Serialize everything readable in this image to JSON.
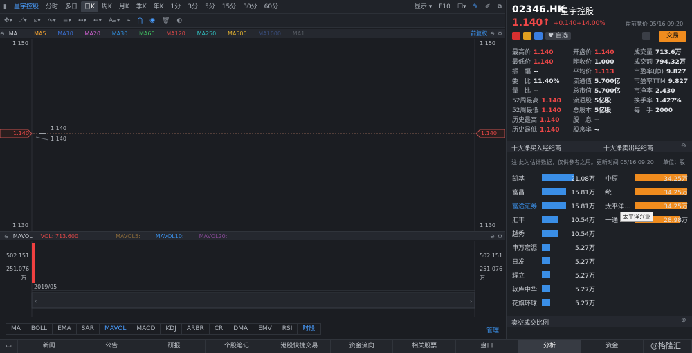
{
  "toolbar": {
    "symbol": "星宇控股",
    "periods": [
      "分时",
      "多日",
      "日K",
      "周K",
      "月K",
      "季K",
      "年K",
      "1分",
      "3分",
      "5分",
      "15分",
      "30分",
      "60分"
    ],
    "active_period": "日K",
    "display_label": "显示",
    "f10_label": "F10"
  },
  "ma_bar": {
    "title": "MA",
    "items": [
      {
        "label": "MA5:",
        "color": "#f0a030"
      },
      {
        "label": "MA10:",
        "color": "#3a6fd0"
      },
      {
        "label": "MA20:",
        "color": "#d060d0"
      },
      {
        "label": "MA30:",
        "color": "#3090e0"
      },
      {
        "label": "MA60:",
        "color": "#40c060"
      },
      {
        "label": "MA120:",
        "color": "#e04848"
      },
      {
        "label": "MA250:",
        "color": "#30c0c0"
      },
      {
        "label": "MA500:",
        "color": "#e0b030"
      },
      {
        "label": "MA1000:",
        "color": "#3a4f80"
      },
      {
        "label": "MA1",
        "color": "#555a62"
      }
    ],
    "adjust_label": "前复权"
  },
  "price_chart": {
    "y_top": "1.150",
    "y_bottom": "1.130",
    "last_price_tag": "1.140",
    "candle_label_1": "1.140",
    "candle_label_2": "1.140"
  },
  "vol_bar": {
    "title": "MAVOL",
    "vol_label": "VOL: 713.600",
    "items": [
      {
        "label": "MAVOL5:",
        "color": "#8a6a3a"
      },
      {
        "label": "MAVOL10:",
        "color": "#3a8ee6"
      },
      {
        "label": "MAVOL20:",
        "color": "#8a4a9a"
      }
    ]
  },
  "vol_chart": {
    "y_top": "502.151",
    "y_mid": "251.076",
    "unit": "万",
    "date_label": "2019/05"
  },
  "indicators": [
    "MA",
    "BOLL",
    "EMA",
    "SAR",
    "MAVOL",
    "MACD",
    "KDJ",
    "ARBR",
    "CR",
    "DMA",
    "EMV",
    "RSI",
    "时段"
  ],
  "active_indicators": [
    "MAVOL",
    "时段"
  ],
  "manage_label": "管理",
  "bottom_nav": [
    "新闻",
    "公告",
    "研报",
    "个股笔记",
    "港股快捷交易",
    "资金流向",
    "相关股票",
    "盘口",
    "分析",
    "资金"
  ],
  "bottom_nav_active": "分析",
  "watermark": "@格隆汇",
  "quote": {
    "code": "02346.HK",
    "name": "星宇控股",
    "price": "1.140",
    "arrow": "↑",
    "change": "+0.140",
    "change_pct": "+14.00%",
    "pre_market": "盘前竞价 05/16 09:20",
    "watchlist_label": "自选",
    "trade_label": "交易",
    "fields": [
      {
        "label": "最高价",
        "value": "1.140",
        "up": true
      },
      {
        "label": "开盘价",
        "value": "1.140",
        "up": true
      },
      {
        "label": "成交量",
        "value": "713.6万",
        "up": false
      },
      {
        "label": "最低价",
        "value": "1.140",
        "up": true
      },
      {
        "label": "昨收价",
        "value": "1.000",
        "up": false
      },
      {
        "label": "成交额",
        "value": "794.32万",
        "up": false
      },
      {
        "label": "振　幅",
        "value": "--",
        "up": false
      },
      {
        "label": "平均价",
        "value": "1.113",
        "up": true
      },
      {
        "label": "市盈率(静)",
        "value": "9.827",
        "up": false
      },
      {
        "label": "委　比",
        "value": "11.40%",
        "up": false
      },
      {
        "label": "流通值",
        "value": "5.700亿",
        "up": false
      },
      {
        "label": "市盈率TTM",
        "value": "9.827",
        "up": false
      },
      {
        "label": "量　比",
        "value": "--",
        "up": false
      },
      {
        "label": "总市值",
        "value": "5.700亿",
        "up": false
      },
      {
        "label": "市净率",
        "value": "2.430",
        "up": false
      },
      {
        "label": "52周最高",
        "value": "1.140",
        "up": true
      },
      {
        "label": "流通股",
        "value": "5亿股",
        "up": false
      },
      {
        "label": "换手率",
        "value": "1.427%",
        "up": false
      },
      {
        "label": "52周最低",
        "value": "1.140",
        "up": true
      },
      {
        "label": "总股本",
        "value": "5亿股",
        "up": false
      },
      {
        "label": "每　手",
        "value": "2000",
        "up": false
      },
      {
        "label": "历史最高",
        "value": "1.140",
        "up": true
      },
      {
        "label": "股　息",
        "value": "--",
        "up": false
      },
      {
        "label": "历史最低",
        "value": "1.140",
        "up": true
      },
      {
        "label": "股息率",
        "value": "--",
        "up": false
      }
    ]
  },
  "brokers": {
    "buy_title": "十大净买入经纪商",
    "sell_title": "十大净卖出经纪商",
    "note": "注:此为估计数据，仅供参考之用。更新时间 05/16 09:20",
    "unit_label": "单位：股",
    "buy": [
      {
        "name": "凯基",
        "value": "21.08万",
        "ratio": 1.0
      },
      {
        "name": "富昌",
        "value": "15.81万",
        "ratio": 0.75
      },
      {
        "name": "富途证券",
        "value": "15.81万",
        "ratio": 0.75,
        "link": true
      },
      {
        "name": "汇丰",
        "value": "10.54万",
        "ratio": 0.5
      },
      {
        "name": "越秀",
        "value": "10.54万",
        "ratio": 0.5
      },
      {
        "name": "申万宏源",
        "value": "5.27万",
        "ratio": 0.25
      },
      {
        "name": "日发",
        "value": "5.27万",
        "ratio": 0.25
      },
      {
        "name": "辉立",
        "value": "5.27万",
        "ratio": 0.25
      },
      {
        "name": "软库中华",
        "value": "5.27万",
        "ratio": 0.25
      },
      {
        "name": "花旗环球",
        "value": "5.27万",
        "ratio": 0.25
      }
    ],
    "sell": [
      {
        "name": "中原",
        "value": "34.25万",
        "ratio": 1.0
      },
      {
        "name": "统一",
        "value": "34.25万",
        "ratio": 1.0
      },
      {
        "name": "太平洋...",
        "value": "34.25万",
        "ratio": 1.0
      },
      {
        "name": "一通",
        "value": "28.98万",
        "ratio": 0.85
      }
    ],
    "tooltip": "太平洋兴业",
    "footer": "卖空成交比例"
  }
}
